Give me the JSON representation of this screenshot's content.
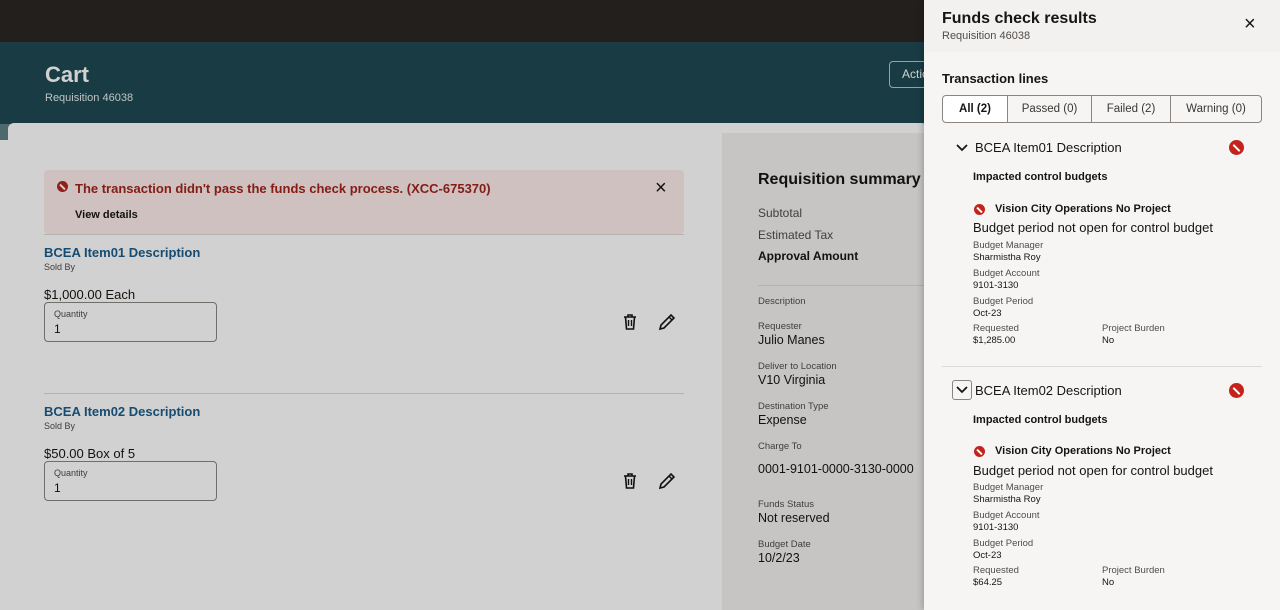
{
  "page": {
    "title": "Cart",
    "subtitle": "Requisition 46038",
    "actions_label": "Actions"
  },
  "alert": {
    "message": "The transaction didn't pass the funds check process. (XCC-675370)",
    "link": "View details"
  },
  "cart_items": [
    {
      "title": "BCEA Item01 Description",
      "sold_by": "Sold By",
      "price": "$1,000.00 Each",
      "quantity_label": "Quantity",
      "quantity": "1"
    },
    {
      "title": "BCEA Item02 Description",
      "sold_by": "Sold By",
      "price": "$50.00 Box of 5",
      "quantity_label": "Quantity",
      "quantity": "1"
    }
  ],
  "summary": {
    "title": "Requisition summary",
    "subtotal_label": "Subtotal",
    "tax_label": "Estimated Tax",
    "approval_label": "Approval Amount",
    "details": [
      {
        "label": "Description",
        "value": ""
      },
      {
        "label": "Requester",
        "value": "Julio Manes"
      },
      {
        "label": "Deliver to Location",
        "value": "V10 Virginia"
      },
      {
        "label": "Destination Type",
        "value": "Expense"
      },
      {
        "label": "Charge To",
        "value": "0001-9101-0000-3130-0000"
      },
      {
        "label": "Funds Status",
        "value": "Not reserved"
      },
      {
        "label": "Budget Date",
        "value": "10/2/23"
      }
    ]
  },
  "drawer": {
    "title": "Funds check results",
    "subtitle": "Requisition 46038",
    "section_title": "Transaction lines",
    "filters": [
      {
        "label": "All (2)",
        "active": true
      },
      {
        "label": "Passed (0)",
        "active": false
      },
      {
        "label": "Failed (2)",
        "active": false
      },
      {
        "label": "Warning (0)",
        "active": false
      }
    ],
    "lines": [
      {
        "name": "BCEA Item01 Description",
        "impacted_label": "Impacted control budgets",
        "budget_name": "Vision City Operations No Project",
        "message": "Budget period not open for control budget",
        "budget_manager_label": "Budget Manager",
        "budget_manager": "Sharmistha Roy",
        "budget_account_label": "Budget Account",
        "budget_account": "9101-3130",
        "budget_period_label": "Budget Period",
        "budget_period": "Oct-23",
        "requested_label": "Requested",
        "requested": "$1,285.00",
        "project_burden_label": "Project Burden",
        "project_burden": "No"
      },
      {
        "name": "BCEA Item02 Description",
        "impacted_label": "Impacted control budgets",
        "budget_name": "Vision City Operations No Project",
        "message": "Budget period not open for control budget",
        "budget_manager_label": "Budget Manager",
        "budget_manager": "Sharmistha Roy",
        "budget_account_label": "Budget Account",
        "budget_account": "9101-3130",
        "budget_period_label": "Budget Period",
        "budget_period": "Oct-23",
        "requested_label": "Requested",
        "requested": "$64.25",
        "project_burden_label": "Project Burden",
        "project_burden": "No"
      }
    ]
  },
  "icons": {
    "close": "close-icon",
    "error": "error-icon",
    "delete": "trash-icon",
    "edit": "pencil-icon",
    "expand": "chevron-down-icon"
  }
}
